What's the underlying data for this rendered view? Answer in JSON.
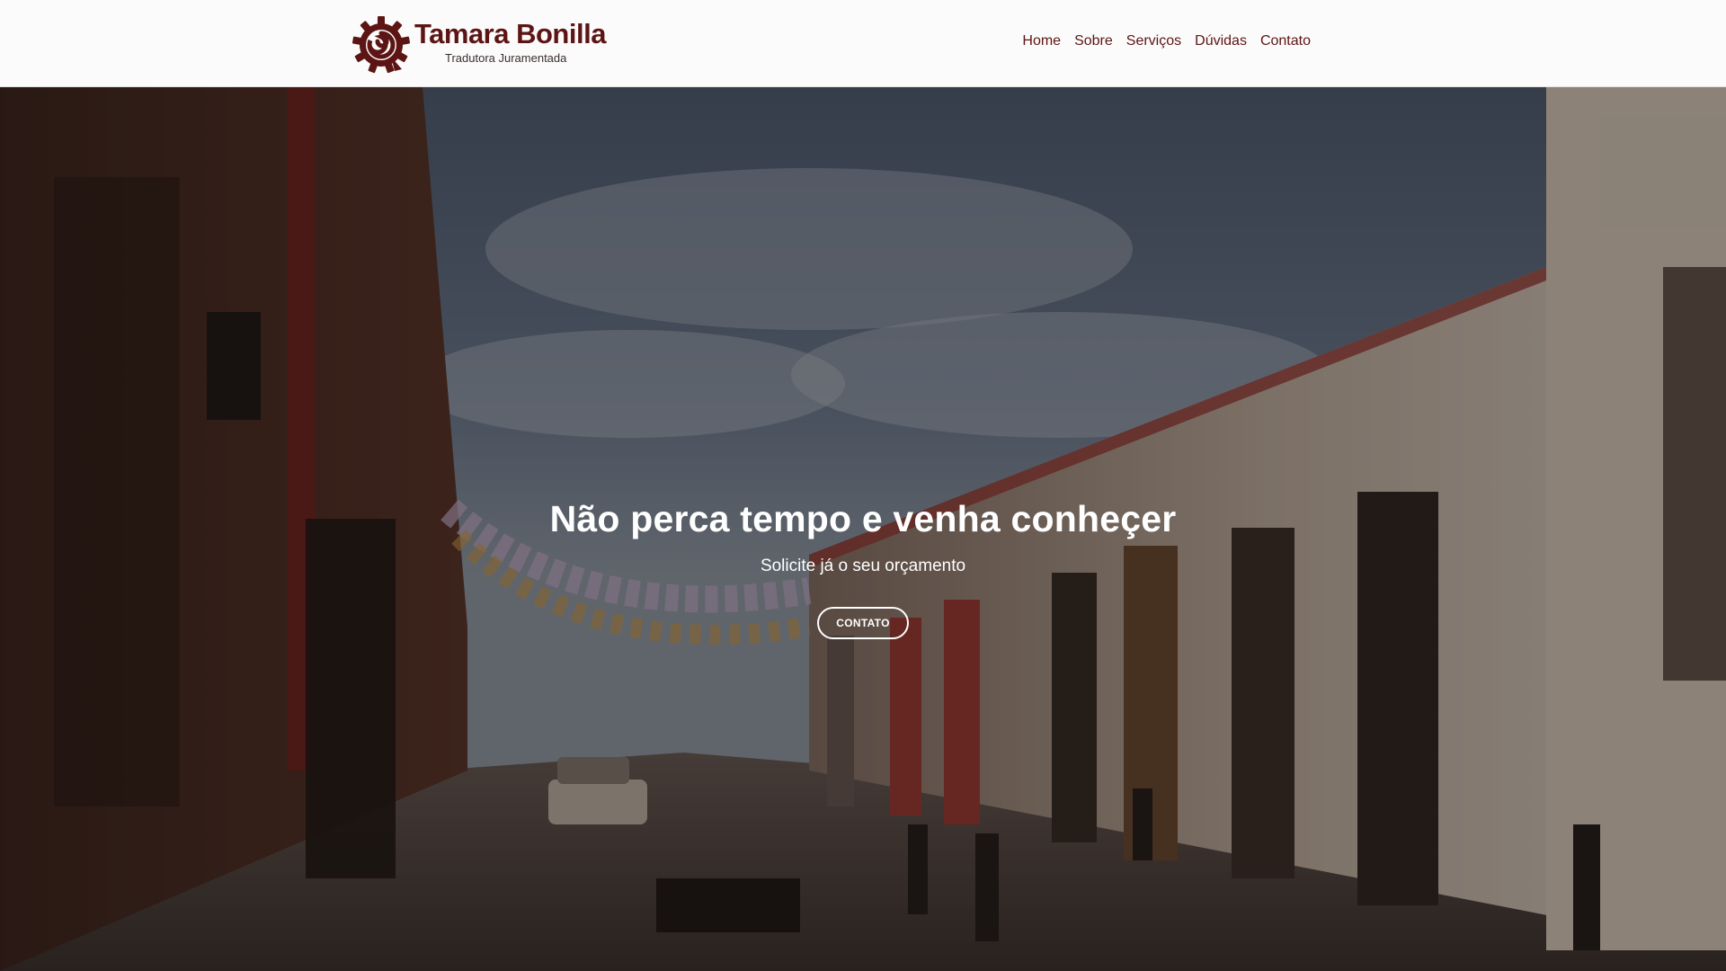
{
  "header": {
    "brand": {
      "name": "Tamara Bonilla",
      "tagline": "Tradutora Juramentada",
      "logo_icon": "gear-spiral-logo-icon"
    },
    "nav": [
      {
        "label": "Home"
      },
      {
        "label": "Sobre"
      },
      {
        "label": "Serviços"
      },
      {
        "label": "Dúvidas"
      },
      {
        "label": "Contato"
      }
    ]
  },
  "hero": {
    "title": "Não perca tempo e venha conheçer",
    "subtitle": "Solicite já o seu orçamento",
    "button_label": "CONTATO"
  },
  "colors": {
    "brand": "#5c1514",
    "header_background": "#fcfbfb",
    "hero_text": "#ffffff"
  }
}
